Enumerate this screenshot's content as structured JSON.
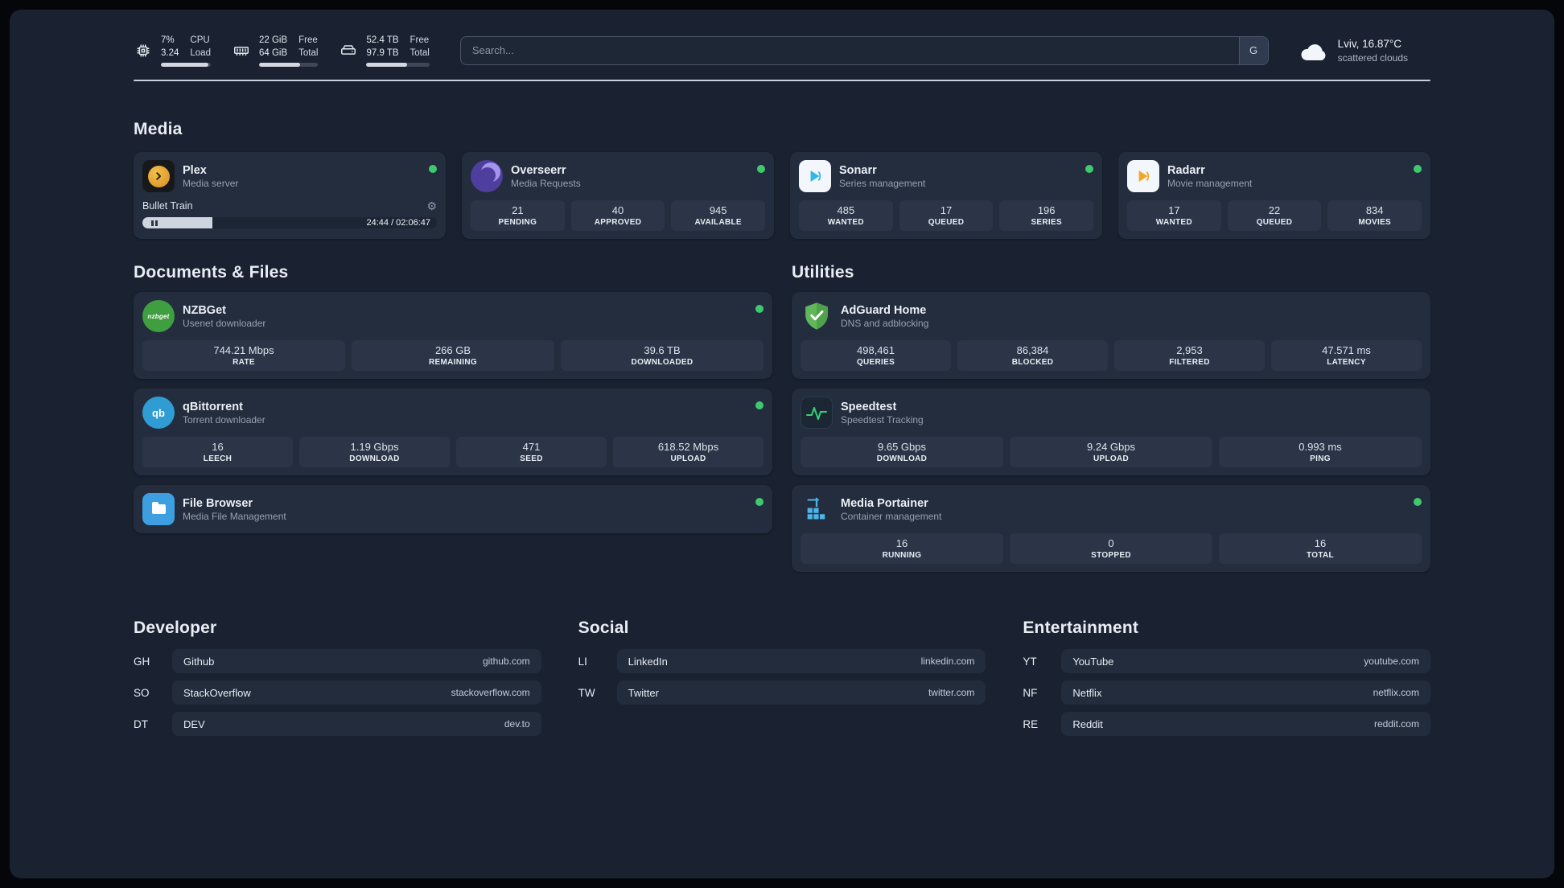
{
  "colors": {
    "status_online": "#3fc96e"
  },
  "icons": {
    "gear": "⚙",
    "nzbget_label": "nzbget",
    "qb_label": "qb"
  },
  "topbar": {
    "cpu": {
      "value_top": "7%",
      "value_bottom": "3.24",
      "label_top": "CPU",
      "label_bottom": "Load",
      "bar_percent": 95
    },
    "memory": {
      "value_top": "22 GiB",
      "value_bottom": "64 GiB",
      "label_top": "Free",
      "label_bottom": "Total",
      "bar_percent": 70
    },
    "disk": {
      "value_top": "52.4 TB",
      "value_bottom": "97.9 TB",
      "label_top": "Free",
      "label_bottom": "Total",
      "bar_percent": 64
    },
    "search": {
      "placeholder": "Search...",
      "button_label": "G"
    },
    "weather": {
      "location": "Lviv, 16.87°C",
      "condition": "scattered clouds"
    }
  },
  "sections": {
    "media": {
      "title": "Media",
      "plex": {
        "name": "Plex",
        "subtitle": "Media server",
        "now_playing": "Bullet Train",
        "time": "24:44 / 02:06:47",
        "progress_percent": 17
      },
      "overseerr": {
        "name": "Overseerr",
        "subtitle": "Media Requests",
        "stats": [
          {
            "value": "21",
            "label": "PENDING"
          },
          {
            "value": "40",
            "label": "APPROVED"
          },
          {
            "value": "945",
            "label": "AVAILABLE"
          }
        ]
      },
      "sonarr": {
        "name": "Sonarr",
        "subtitle": "Series management",
        "stats": [
          {
            "value": "485",
            "label": "WANTED"
          },
          {
            "value": "17",
            "label": "QUEUED"
          },
          {
            "value": "196",
            "label": "SERIES"
          }
        ]
      },
      "radarr": {
        "name": "Radarr",
        "subtitle": "Movie management",
        "stats": [
          {
            "value": "17",
            "label": "WANTED"
          },
          {
            "value": "22",
            "label": "QUEUED"
          },
          {
            "value": "834",
            "label": "MOVIES"
          }
        ]
      }
    },
    "documents": {
      "title": "Documents & Files",
      "nzbget": {
        "name": "NZBGet",
        "subtitle": "Usenet downloader",
        "stats": [
          {
            "value": "744.21 Mbps",
            "label": "RATE"
          },
          {
            "value": "266 GB",
            "label": "REMAINING"
          },
          {
            "value": "39.6 TB",
            "label": "DOWNLOADED"
          }
        ]
      },
      "qbittorrent": {
        "name": "qBittorrent",
        "subtitle": "Torrent downloader",
        "stats": [
          {
            "value": "16",
            "label": "LEECH"
          },
          {
            "value": "1.19 Gbps",
            "label": "DOWNLOAD"
          },
          {
            "value": "471",
            "label": "SEED"
          },
          {
            "value": "618.52 Mbps",
            "label": "UPLOAD"
          }
        ]
      },
      "filebrowser": {
        "name": "File Browser",
        "subtitle": "Media File Management"
      }
    },
    "utilities": {
      "title": "Utilities",
      "adguard": {
        "name": "AdGuard Home",
        "subtitle": "DNS and adblocking",
        "stats": [
          {
            "value": "498,461",
            "label": "QUERIES"
          },
          {
            "value": "86,384",
            "label": "BLOCKED"
          },
          {
            "value": "2,953",
            "label": "FILTERED"
          },
          {
            "value": "47.571 ms",
            "label": "LATENCY"
          }
        ]
      },
      "speedtest": {
        "name": "Speedtest",
        "subtitle": "Speedtest Tracking",
        "stats": [
          {
            "value": "9.65 Gbps",
            "label": "DOWNLOAD"
          },
          {
            "value": "9.24 Gbps",
            "label": "UPLOAD"
          },
          {
            "value": "0.993 ms",
            "label": "PING"
          }
        ]
      },
      "portainer": {
        "name": "Media Portainer",
        "subtitle": "Container management",
        "stats": [
          {
            "value": "16",
            "label": "RUNNING"
          },
          {
            "value": "0",
            "label": "STOPPED"
          },
          {
            "value": "16",
            "label": "TOTAL"
          }
        ]
      }
    }
  },
  "bookmarks": [
    {
      "title": "Developer",
      "links": [
        {
          "abbr": "GH",
          "name": "Github",
          "url": "github.com"
        },
        {
          "abbr": "SO",
          "name": "StackOverflow",
          "url": "stackoverflow.com"
        },
        {
          "abbr": "DT",
          "name": "DEV",
          "url": "dev.to"
        }
      ]
    },
    {
      "title": "Social",
      "links": [
        {
          "abbr": "LI",
          "name": "LinkedIn",
          "url": "linkedin.com"
        },
        {
          "abbr": "TW",
          "name": "Twitter",
          "url": "twitter.com"
        }
      ]
    },
    {
      "title": "Entertainment",
      "links": [
        {
          "abbr": "YT",
          "name": "YouTube",
          "url": "youtube.com"
        },
        {
          "abbr": "NF",
          "name": "Netflix",
          "url": "netflix.com"
        },
        {
          "abbr": "RE",
          "name": "Reddit",
          "url": "reddit.com"
        }
      ]
    }
  ]
}
